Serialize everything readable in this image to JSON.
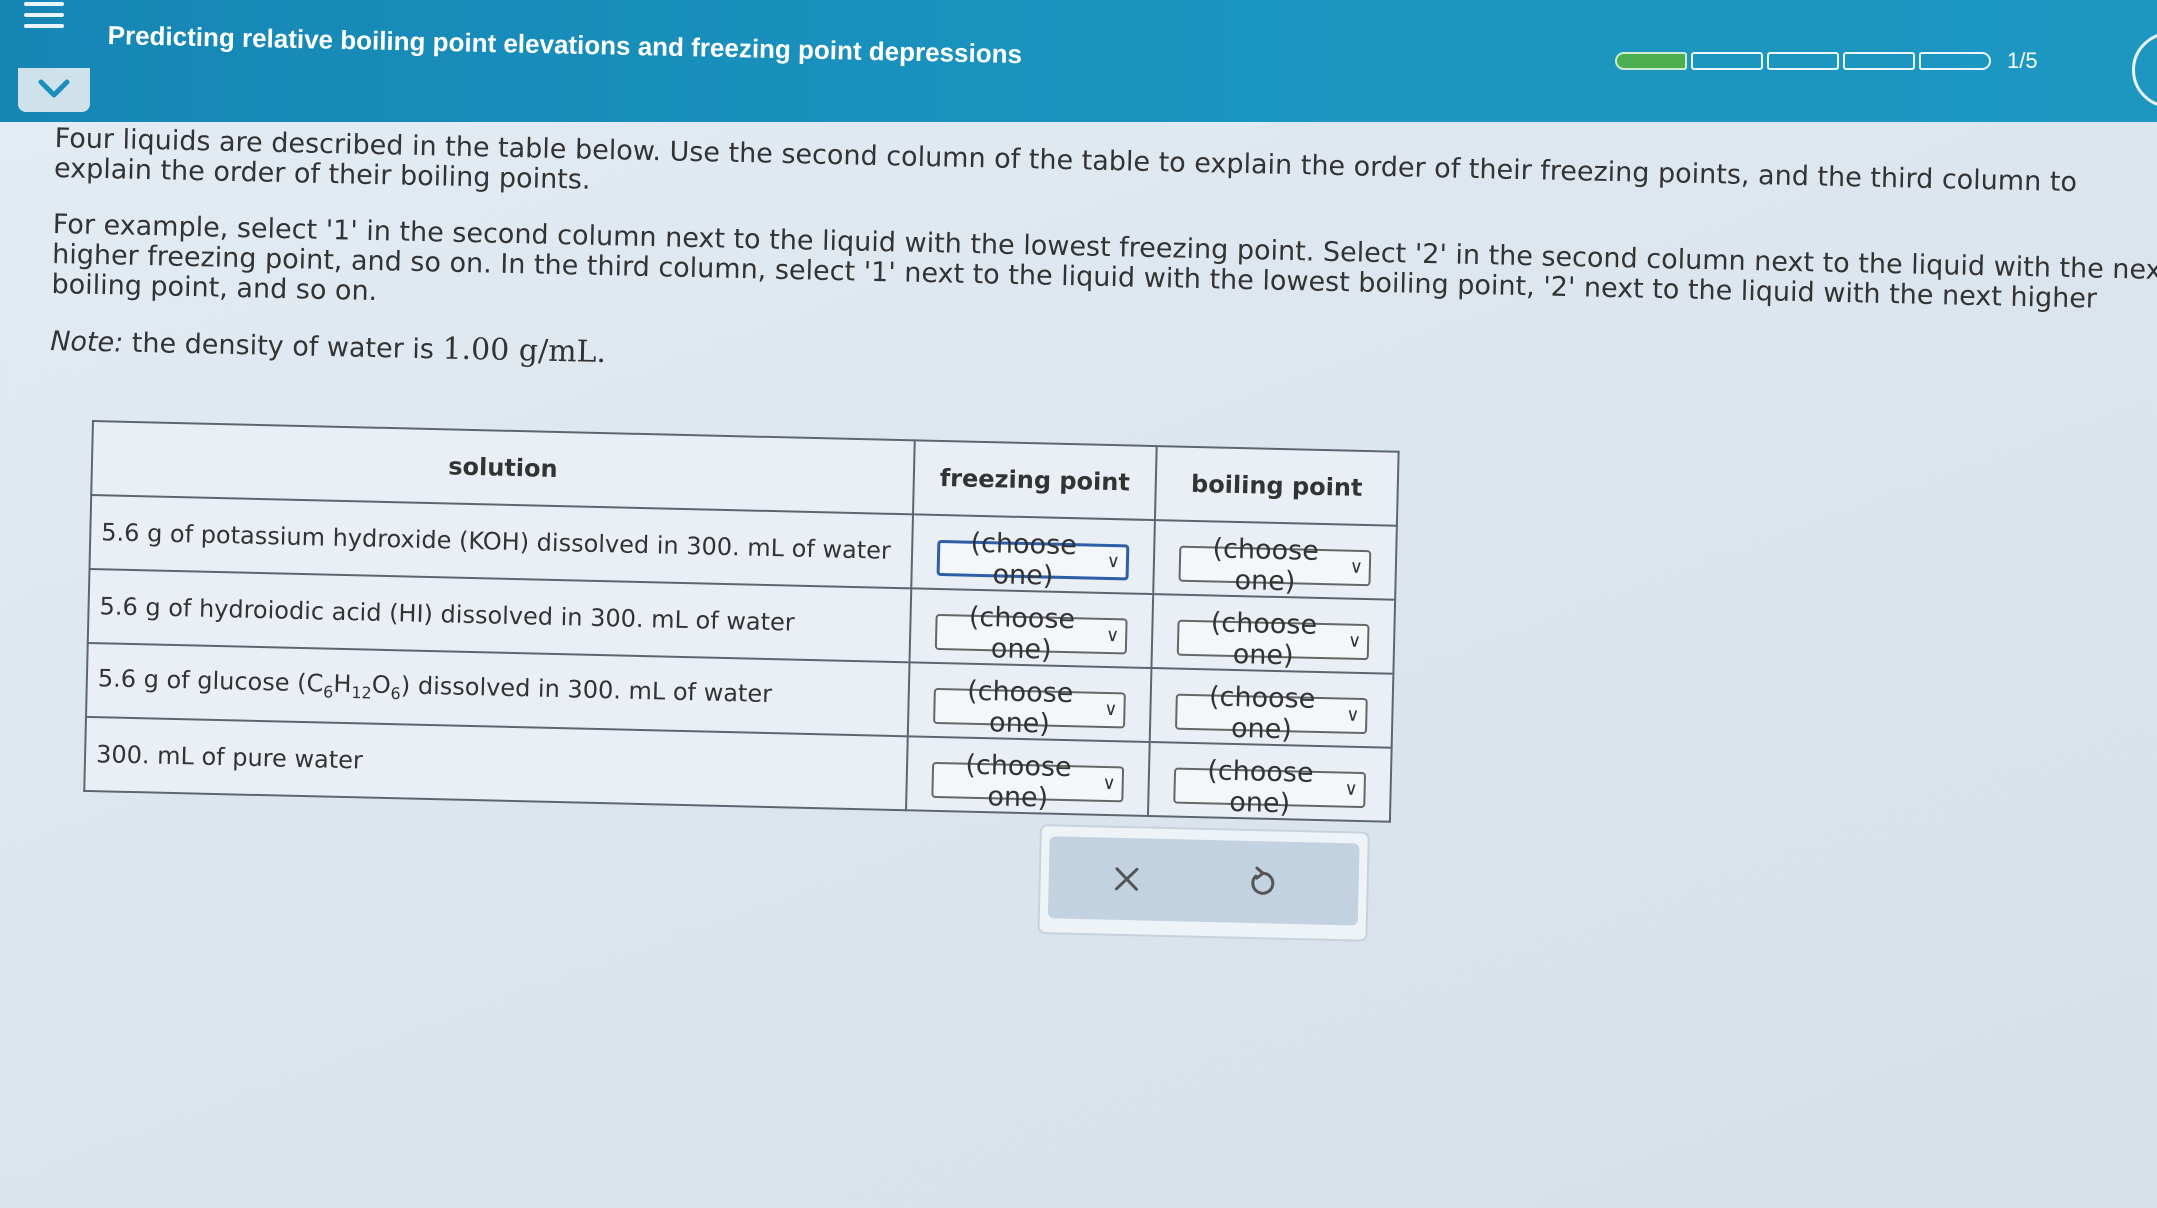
{
  "header": {
    "title": "Predicting relative boiling point elevations and freezing point depressions",
    "progress_label": "1/5",
    "progress_filled_segments": 1,
    "progress_total_segments": 5,
    "accent_color": "#1a8fbd",
    "progress_color": "#4caf50"
  },
  "instructions": {
    "para1": "Four liquids are described in the table below. Use the second column of the table to explain the order of their freezing points, and the third column to explain the order of their boiling points.",
    "para2": "For example, select '1' in the second column next to the liquid with the lowest freezing point. Select '2' in the second column next to the liquid with the next higher freezing point, and so on. In the third column, select '1' next to the liquid with the lowest boiling point, '2' next to the liquid with the next higher boiling point, and so on.",
    "note_label": "Note:",
    "note_text": " the density of water is ",
    "note_value": "1.00 g/mL."
  },
  "table": {
    "headers": [
      "solution",
      "freezing point",
      "boiling point"
    ],
    "rows": [
      {
        "solution_pre": "5.6 g of potassium hydroxide (KOH) dissolved in 300. mL of water",
        "freezing": "(choose one)",
        "boiling": "(choose one)"
      },
      {
        "solution_pre": "5.6 g of hydroiodic acid (HI) dissolved in 300. mL of water",
        "freezing": "(choose one)",
        "boiling": "(choose one)"
      },
      {
        "solution_pre": "5.6 g of glucose (C",
        "sub1": "6",
        "mid1": "H",
        "sub2": "12",
        "mid2": "O",
        "sub3": "6",
        "solution_post": ") dissolved in 300. mL of water",
        "freezing": "(choose one)",
        "boiling": "(choose one)"
      },
      {
        "solution_pre": "300. mL of pure water",
        "freezing": "(choose one)",
        "boiling": "(choose one)"
      }
    ]
  },
  "actions": {
    "clear_icon": "close-icon",
    "undo_icon": "undo-icon"
  }
}
